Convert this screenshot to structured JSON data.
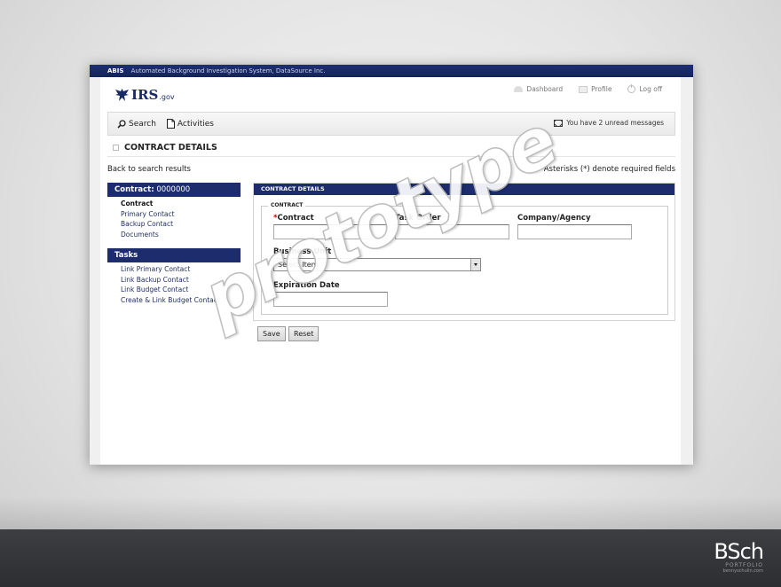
{
  "topbar": {
    "abbr": "ABIS",
    "title": "Automated Background Investigation System, DataSource Inc."
  },
  "logo": {
    "name": "IRS",
    "suffix": ".gov"
  },
  "toplinks": {
    "dashboard": "Dashboard",
    "profile": "Profile",
    "logoff": "Log off"
  },
  "nav": {
    "search": "Search",
    "activities": "Activities",
    "messages": "You have 2 unread messages"
  },
  "page": {
    "title": "CONTRACT DETAILS",
    "back": "Back to search results",
    "required_note": "Asterisks (*) denote required fields"
  },
  "sidebar": {
    "contract_label": "Contract:",
    "contract_number": "0000000",
    "items": [
      "Contract",
      "Primary Contact",
      "Backup Contact",
      "Documents"
    ],
    "tasks_title": "Tasks",
    "tasks": [
      "Link Primary Contact",
      "Link Backup Contact",
      "Link Budget Contact",
      "Create & Link Budget Contact"
    ]
  },
  "panel": {
    "title": "CONTRACT DETAILS",
    "legend": "CONTRACT",
    "required_mark": "*",
    "contract_label": "Contract",
    "task_order_label": "Task Order",
    "company_label": "Company/Agency",
    "business_unit_label": "Business Unit",
    "business_unit_value": "Select Item",
    "expiration_label": "Expiration Date",
    "contract_value": "",
    "task_order_value": "",
    "company_value": "",
    "expiration_value": ""
  },
  "buttons": {
    "save": "Save",
    "reset": "Reset"
  },
  "watermark": "prototype",
  "branding": {
    "mark": "BSch",
    "line1": "PORTFOLIO",
    "line2": "bennyschulin.com"
  },
  "colors": {
    "header_navy": "#1c2c6c",
    "required_red": "#cc0000",
    "footer_dark": "#333538"
  }
}
